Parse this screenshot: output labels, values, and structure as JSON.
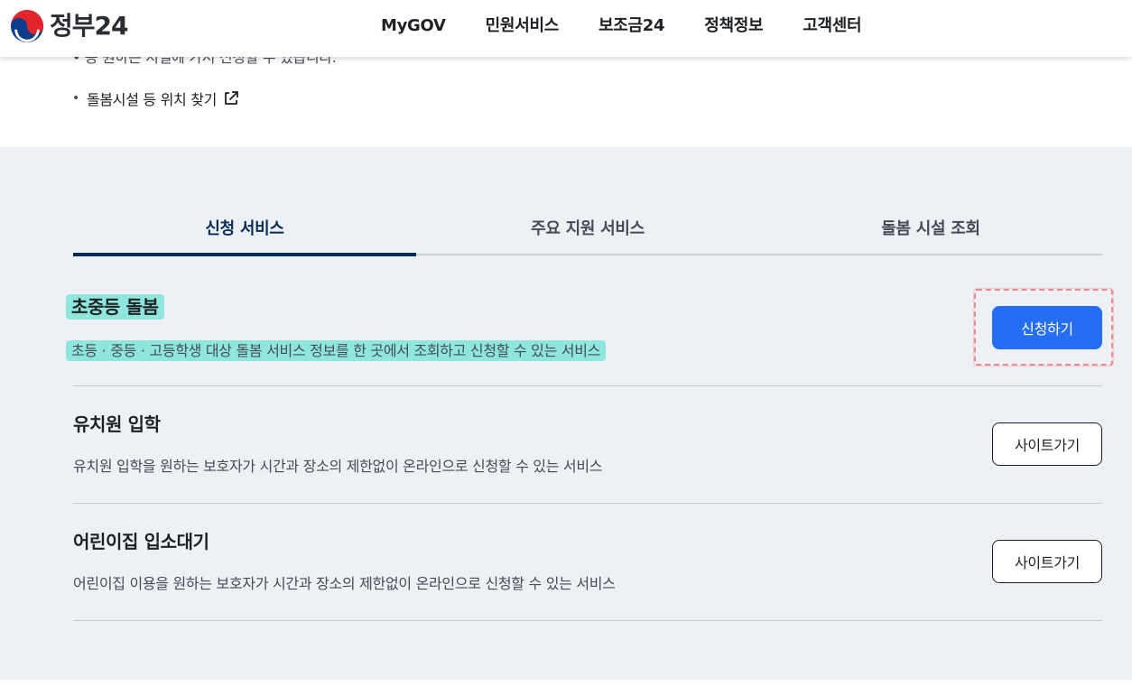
{
  "header": {
    "logo_text": "정부24",
    "nav": [
      "MyGOV",
      "민원서비스",
      "보조금24",
      "정책정보",
      "고객센터"
    ]
  },
  "top": {
    "clipped_text": "• 등 원하는 시설에 가서 신청할 수 있습니다.",
    "link_text": "돌봄시설 등 위치 찾기"
  },
  "tabs": [
    "신청 서비스",
    "주요 지원 서비스",
    "돌봄 시설 조회"
  ],
  "active_tab": "신청 서비스",
  "services": [
    {
      "title": "초중등 돌봄",
      "description": "초등 · 중등 · 고등학생 대상 돌봄 서비스 정보를 한 곳에서 조회하고 신청할 수 있는 서비스",
      "button": "신청하기"
    },
    {
      "title": "유치원 입학",
      "description": "유치원 입학을 원하는 보호자가 시간과 장소의 제한없이 온라인으로 신청할 수 있는 서비스",
      "button": "사이트가기"
    },
    {
      "title": "어린이집 입소대기",
      "description": "어린이집 이용을 원하는 보호자가 시간과 장소의 제한없이 온라인으로 신청할 수 있는 서비스",
      "button": "사이트가기"
    }
  ],
  "colors": {
    "primary": "#256ef4",
    "navy": "#052b57",
    "highlight": "#8fe6dc",
    "section_bg": "#edf0f4"
  },
  "icons": {
    "logo": "taegeuk-logo-icon",
    "external_link": "external-link-icon"
  }
}
